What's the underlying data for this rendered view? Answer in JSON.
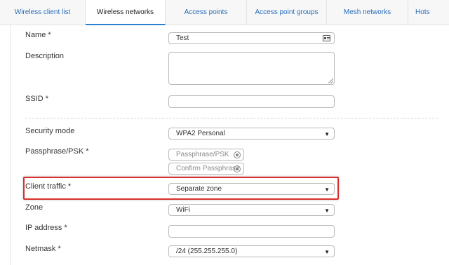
{
  "tabs": [
    {
      "label": "Wireless client list",
      "active": false
    },
    {
      "label": "Wireless networks",
      "active": true
    },
    {
      "label": "Access points",
      "active": false
    },
    {
      "label": "Access point groups",
      "active": false
    },
    {
      "label": "Mesh networks",
      "active": false
    },
    {
      "label": "Hots",
      "active": false
    }
  ],
  "form": {
    "name": {
      "label": "Name *",
      "value": "Test",
      "icon": "id-card-icon"
    },
    "description": {
      "label": "Description",
      "value": ""
    },
    "ssid": {
      "label": "SSID *",
      "value": ""
    },
    "security_mode": {
      "label": "Security mode",
      "value": "WPA2 Personal"
    },
    "passphrase": {
      "label": "Passphrase/PSK *",
      "placeholder": "Passphrase/PSK",
      "confirm_placeholder": "Confirm Passphrase"
    },
    "client_traffic": {
      "label": "Client traffic *",
      "value": "Separate zone"
    },
    "zone": {
      "label": "Zone",
      "value": "WiFi"
    },
    "ip_address": {
      "label": "IP address *",
      "value": ""
    },
    "netmask": {
      "label": "Netmask *",
      "value": "/24 (255.255.255.0)"
    }
  },
  "colors": {
    "accent": "#2a7fd1",
    "link": "#2a6ebb",
    "highlight_border": "#d9302f"
  },
  "dropdown_caret": "▼"
}
